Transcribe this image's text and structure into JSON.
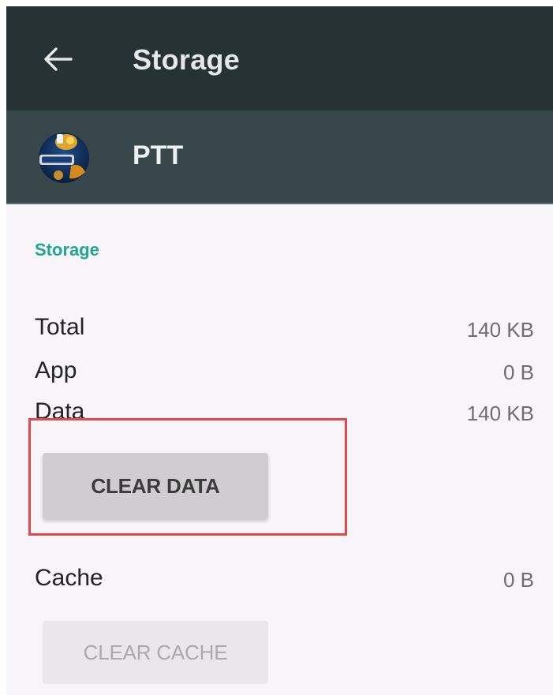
{
  "toolbar": {
    "back_icon": "arrow-left-icon",
    "title": "Storage"
  },
  "app": {
    "icon": "ptt-app-icon",
    "name": "PTT"
  },
  "storage": {
    "section_label": "Storage",
    "rows": [
      {
        "label": "Total",
        "value": "140 KB"
      },
      {
        "label": "App",
        "value": "0 B"
      },
      {
        "label": "Data",
        "value": "140 KB"
      }
    ],
    "clear_data_label": "CLEAR DATA"
  },
  "cache": {
    "label": "Cache",
    "value": "0 B",
    "clear_cache_label": "CLEAR CACHE"
  },
  "colors": {
    "toolbar_bg": "#263234",
    "header_bg": "#37474a",
    "accent": "#20a78e",
    "highlight": "#e04a4e"
  }
}
